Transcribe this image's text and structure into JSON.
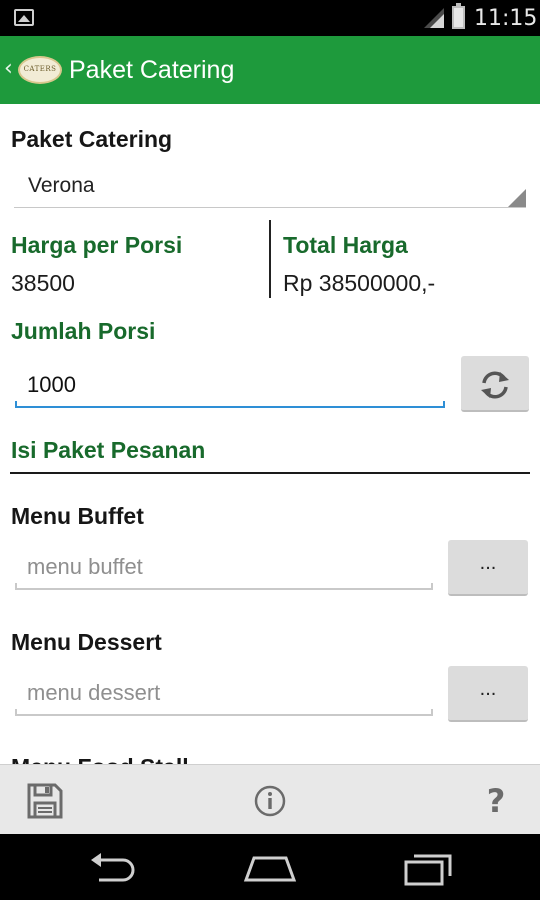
{
  "status_bar": {
    "time": "11:15"
  },
  "action_bar": {
    "logo_text": "CATERS",
    "title": "Paket Catering"
  },
  "form": {
    "paket_label": "Paket Catering",
    "paket_selected": "Verona",
    "harga_label": "Harga per Porsi",
    "harga_value": "38500",
    "total_label": "Total Harga",
    "total_value": "Rp 38500000,-",
    "jumlah_label": "Jumlah Porsi",
    "jumlah_value": "1000",
    "section_title": "Isi Paket Pesanan",
    "menu_buffet_label": "Menu Buffet",
    "menu_buffet_placeholder": "menu buffet",
    "menu_dessert_label": "Menu Dessert",
    "menu_dessert_placeholder": "menu dessert",
    "menu_foodstall_label": "Menu Food Stall",
    "browse_button_label": "..."
  },
  "toolbar": {
    "icons": [
      "save-icon",
      "info-icon",
      "help-icon"
    ],
    "help_glyph": "?"
  },
  "nav": {
    "icons": [
      "back-icon",
      "home-icon",
      "recent-apps-icon"
    ]
  },
  "colors": {
    "action_bar": "#1e9a3c",
    "label_green": "#186a2c",
    "field_focus": "#2e8fd6"
  }
}
